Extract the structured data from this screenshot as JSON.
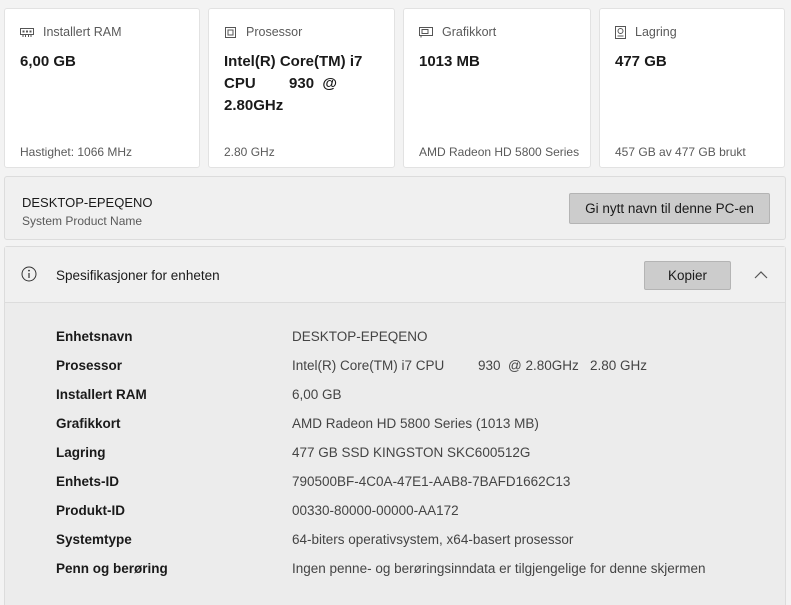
{
  "cards": [
    {
      "icon": "ram-icon",
      "label": "Installert RAM",
      "value": "6,00 GB",
      "sub": "Hastighet: 1066 MHz"
    },
    {
      "icon": "processor-icon",
      "label": "Prosessor",
      "value": "Intel(R) Core(TM) i7\nCPU        930  @\n2.80GHz",
      "sub": "2.80 GHz"
    },
    {
      "icon": "graphics-card-icon",
      "label": "Grafikkort",
      "value": "1013 MB",
      "sub": "AMD Radeon HD 5800 Series"
    },
    {
      "icon": "storage-icon",
      "label": "Lagring",
      "value": "477 GB",
      "sub": "457 GB av 477 GB brukt"
    }
  ],
  "device": {
    "name": "DESKTOP-EPEQENO",
    "model": "System Product Name",
    "rename_label": "Gi nytt navn til denne PC-en"
  },
  "specs": {
    "title": "Spesifikasjoner for enheten",
    "copy_label": "Kopier",
    "rows": [
      {
        "key": "Enhetsnavn",
        "value": "DESKTOP-EPEQENO"
      },
      {
        "key": "Prosessor",
        "value": "Intel(R) Core(TM) i7 CPU         930  @ 2.80GHz   2.80 GHz"
      },
      {
        "key": "Installert RAM",
        "value": "6,00 GB"
      },
      {
        "key": "Grafikkort",
        "value": "AMD Radeon HD 5800 Series (1013 MB)"
      },
      {
        "key": "Lagring",
        "value": "477 GB SSD KINGSTON SKC600512G"
      },
      {
        "key": "Enhets-ID",
        "value": "790500BF-4C0A-47E1-AAB8-7BAFD1662C13"
      },
      {
        "key": "Produkt-ID",
        "value": "00330-80000-00000-AA172"
      },
      {
        "key": "Systemtype",
        "value": "64-biters operativsystem, x64-basert prosessor"
      },
      {
        "key": "Penn og berøring",
        "value": "Ingen penne- og berøringsinndata er tilgjengelige for denne skjermen"
      }
    ]
  }
}
